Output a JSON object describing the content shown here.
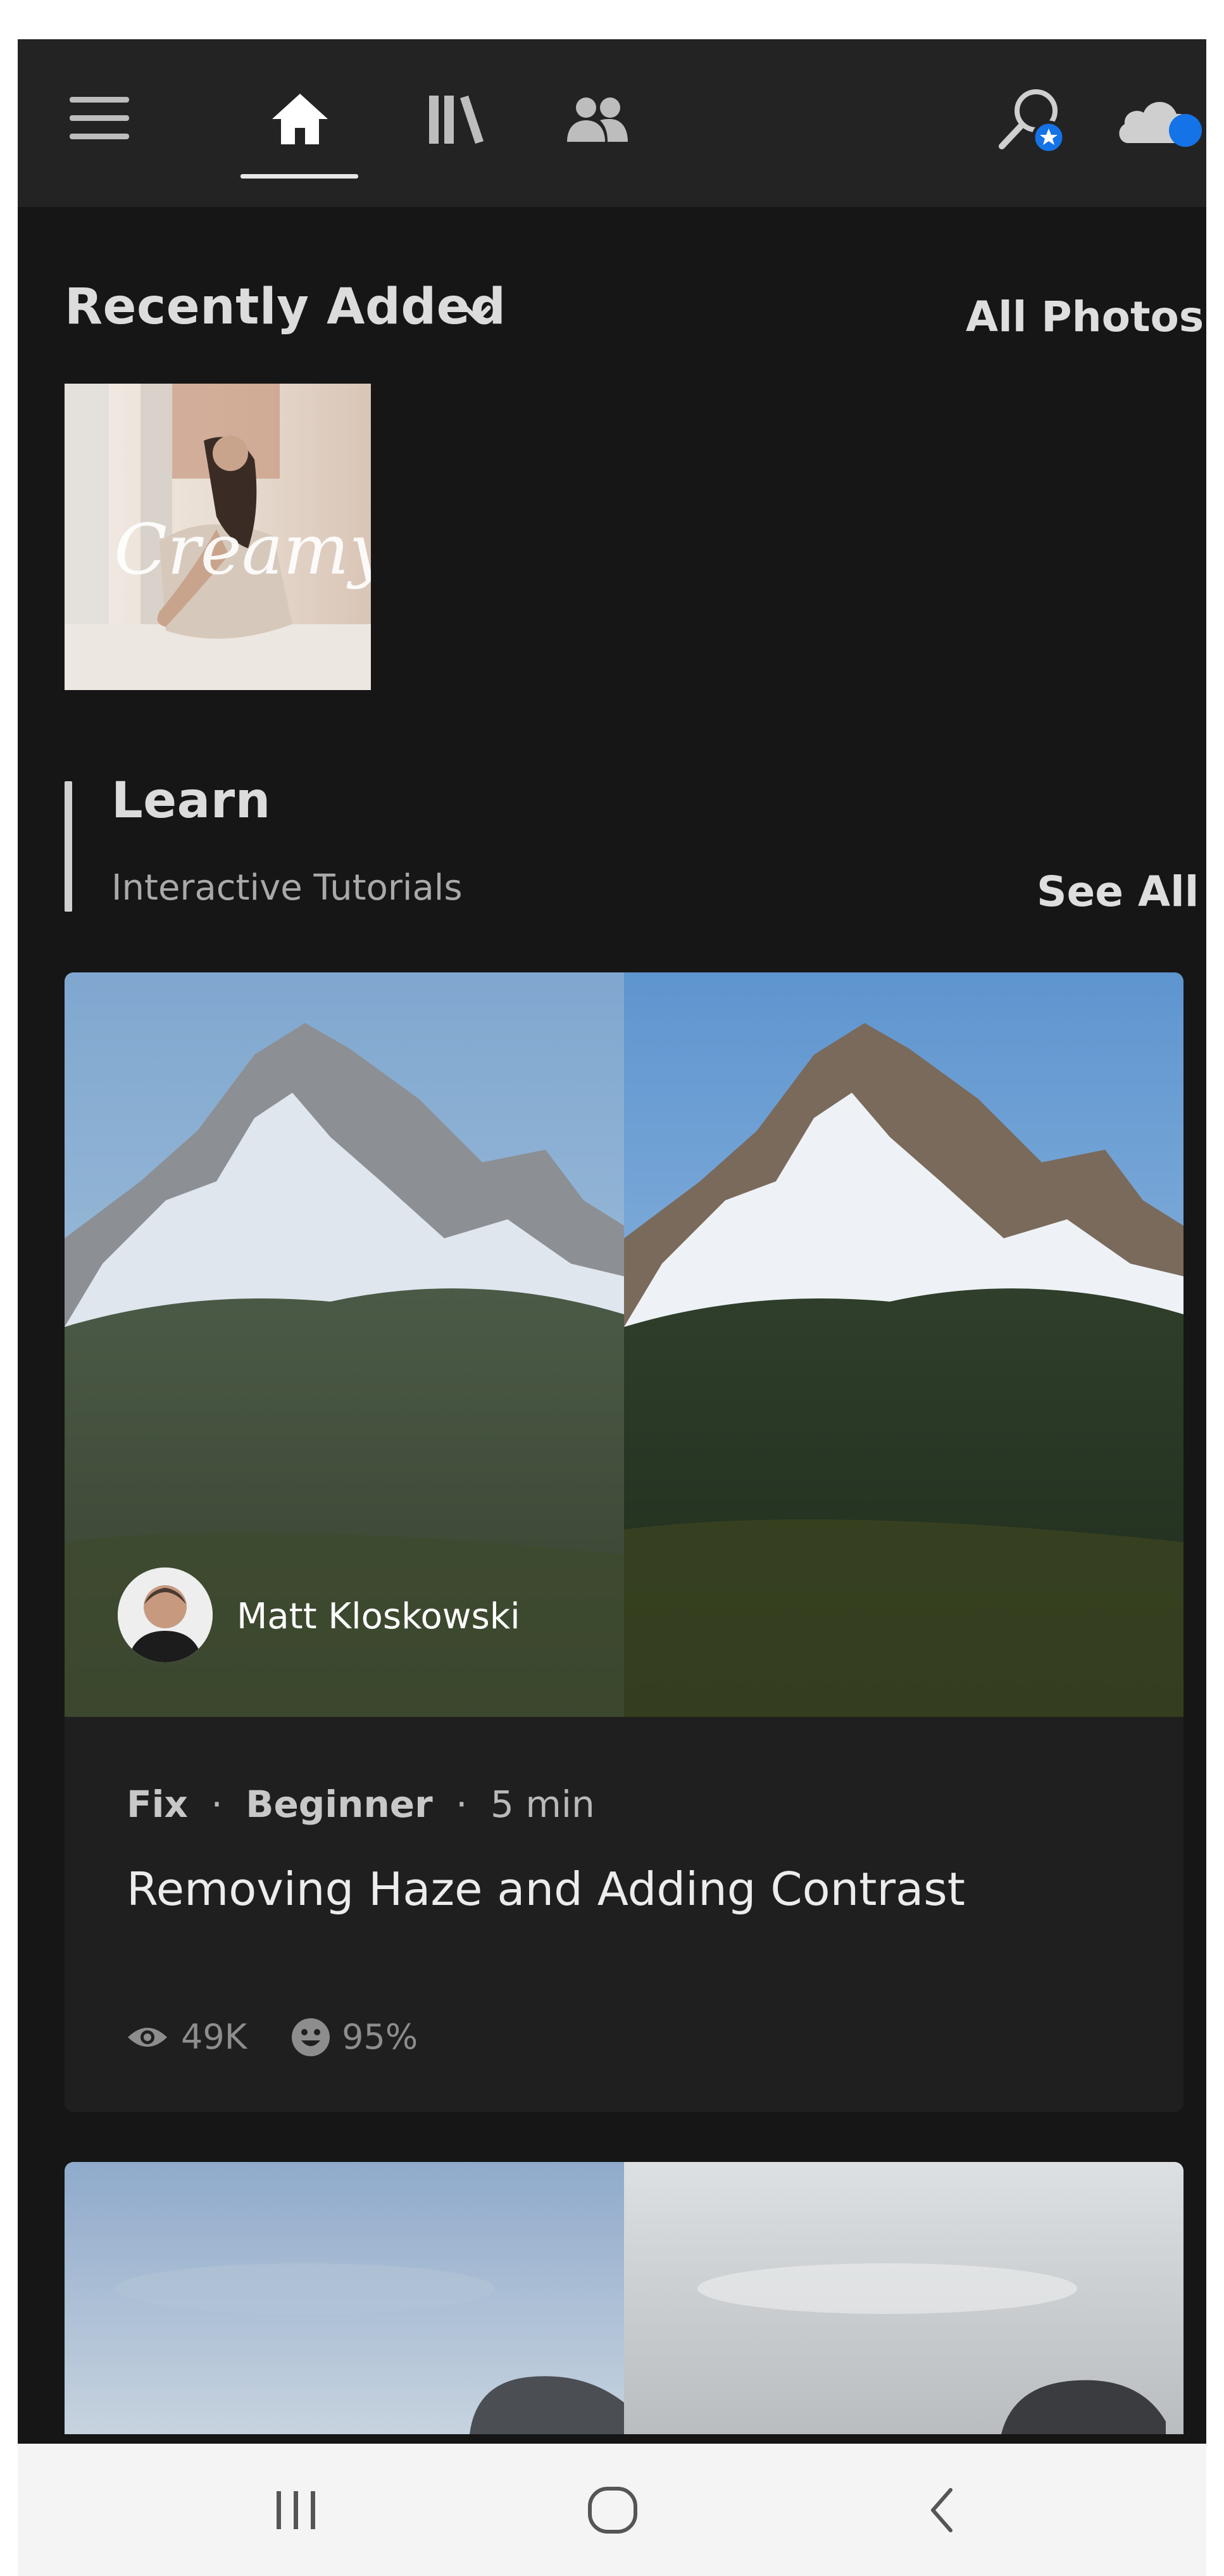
{
  "nav": {
    "menu_icon": "hamburger-menu-icon",
    "tabs": [
      {
        "icon": "home-icon",
        "active": true
      },
      {
        "icon": "library-icon",
        "active": false
      },
      {
        "icon": "people-icon",
        "active": false
      }
    ],
    "search_icon": "search-people-star-icon",
    "cloud_icon": "cloud-sync-icon",
    "accent": "#1473e6"
  },
  "recent": {
    "title": "Recently Added",
    "all_photos": "All Photos",
    "thumbnail": {
      "overlay_text": "Creamy"
    }
  },
  "learn": {
    "title": "Learn",
    "subtitle": "Interactive Tutorials",
    "see_all": "See All"
  },
  "card": {
    "author": "Matt Kloskowski",
    "category": "Fix",
    "level": "Beginner",
    "duration": "5 min",
    "title": "Removing Haze and Adding Contrast",
    "views": "49K",
    "rating": "95%",
    "separator": "·"
  },
  "android_nav": {
    "recents_icon": "recent-apps-icon",
    "home_icon": "android-home-icon",
    "back_icon": "android-back-icon"
  }
}
